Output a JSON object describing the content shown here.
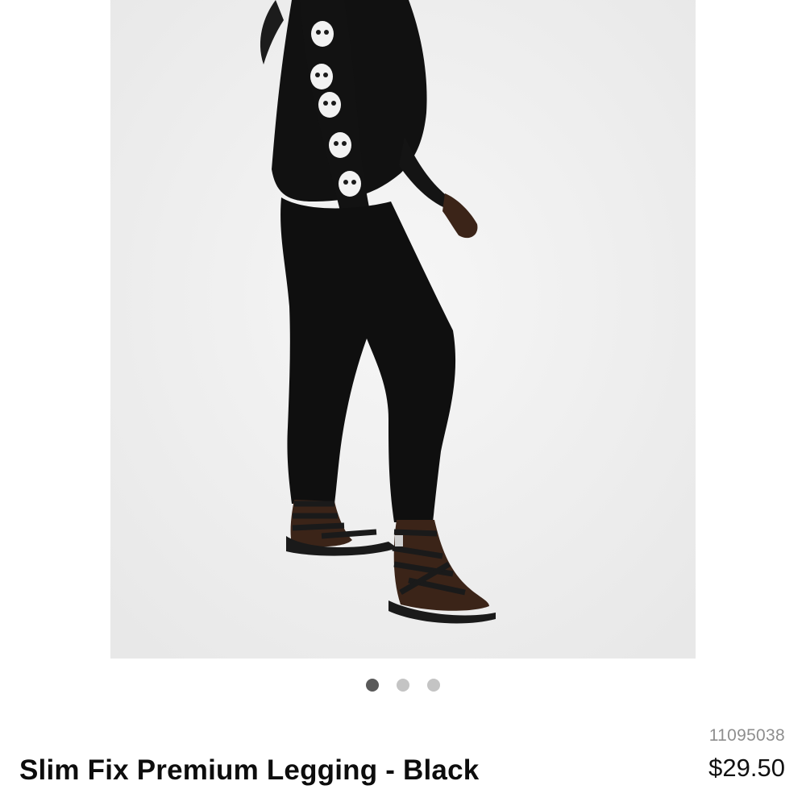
{
  "product": {
    "title": "Slim Fix Premium Legging - Black",
    "sku": "11095038",
    "price": "$29.50",
    "image_alt": "model wearing black leggings, black skull-print long sleeve top and black strappy sandals"
  },
  "carousel": {
    "dots": [
      {
        "name": "carousel-dot-1",
        "active": true
      },
      {
        "name": "carousel-dot-2",
        "active": false
      },
      {
        "name": "carousel-dot-3",
        "active": false
      }
    ],
    "active_index": 1,
    "total": 3
  },
  "colors": {
    "background": "#ffffff",
    "image_background": "#f0f0f0",
    "dot_active": "#595959",
    "dot_inactive": "#c4c4c4",
    "sku_text": "#8e8e8e"
  }
}
